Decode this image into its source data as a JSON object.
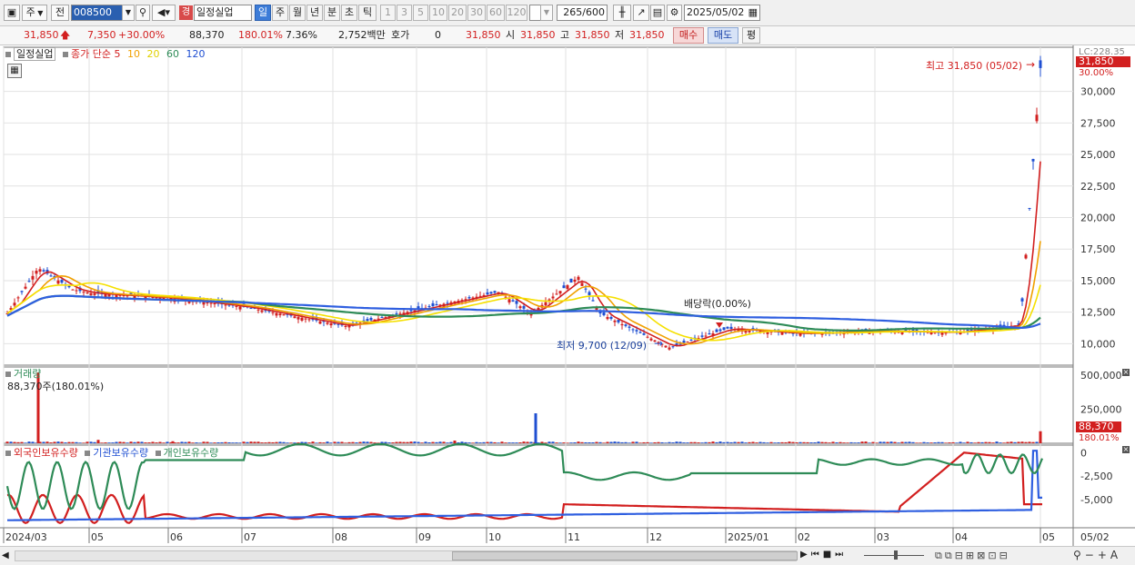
{
  "toolbar": {
    "mode_label": "주",
    "prev_label": "전",
    "code": "008500",
    "badge": "경",
    "stock_name": "일정실업",
    "periods": [
      "일",
      "주",
      "월",
      "년",
      "분",
      "초",
      "틱"
    ],
    "active_period": "일",
    "intervals": [
      "1",
      "3",
      "5",
      "10",
      "20",
      "30",
      "60",
      "120"
    ],
    "count_value": "265",
    "count_total": "/600",
    "date": "2025/05/02"
  },
  "quote": {
    "price": "31,850",
    "change": "7,350",
    "change_pct": "+30.00%",
    "volume": "88,370",
    "volume_ratio": "180.01%",
    "turnover": "7.36%",
    "amount": "2,752백만",
    "hoga_label": "호가",
    "hoga_value": "0",
    "hoga_price": "31,850",
    "open_label": "시",
    "open": "31,850",
    "high_label": "고",
    "high": "31,850",
    "low_label": "저",
    "low": "31,850",
    "buy_label": "매수",
    "sell_label": "매도",
    "flat_label": "평",
    "colors": {
      "up": "#d21f1f",
      "down": "#1f4fd2",
      "selected": "#3c7cd8"
    }
  },
  "price_legend": {
    "name": "일정실업",
    "ma_label": "종가 단순 5",
    "ma10": "10",
    "ma20": "20",
    "ma60": "60",
    "ma120": "120"
  },
  "annotations": {
    "high": "최고 31,850 (05/02)",
    "low": "최저 9,700 (12/09)",
    "dividend": "배당락(0.00%)",
    "current_price": "31,850",
    "current_pct": "30.00%",
    "lc": "LC:228.35"
  },
  "volume_panel": {
    "title": "거래량",
    "info": "88,370주(180.01%)",
    "current": "88,370",
    "current_pct": "180.01%"
  },
  "holding_panel": {
    "foreign": "외국인보유수량",
    "institution": "기관보유수량",
    "individual": "개인보유수량"
  },
  "chart_data": [
    {
      "type": "candlestick",
      "name": "price",
      "y_ticks": [
        "30,000",
        "27,500",
        "25,000",
        "22,500",
        "20,000",
        "17,500",
        "15,000",
        "12,500",
        "10,000"
      ],
      "ylim": [
        8300,
        33500
      ],
      "x_ticks": [
        "2024/03",
        "05",
        "06",
        "07",
        "08",
        "09",
        "10",
        "11",
        "12",
        "2025/01",
        "02",
        "03",
        "04",
        "05"
      ],
      "x_end_label": "05/02",
      "close_series": [
        {
          "date": "2024/03",
          "value": 12400
        },
        {
          "date": "2024/03 mid",
          "value": 16000
        },
        {
          "date": "2024/04",
          "value": 14300
        },
        {
          "date": "2024/05",
          "value": 14000
        },
        {
          "date": "2024/06",
          "value": 13600
        },
        {
          "date": "2024/07",
          "value": 12900
        },
        {
          "date": "2024/08",
          "value": 11400
        },
        {
          "date": "2024/09",
          "value": 12800
        },
        {
          "date": "2024/10",
          "value": 14100
        },
        {
          "date": "2024/10 end",
          "value": 12400
        },
        {
          "date": "2024/11",
          "value": 15300
        },
        {
          "date": "2024/11 end",
          "value": 12400
        },
        {
          "date": "2024/12/09",
          "value": 9700
        },
        {
          "date": "2025/01",
          "value": 11200
        },
        {
          "date": "2025/02",
          "value": 10800
        },
        {
          "date": "2025/03",
          "value": 11000
        },
        {
          "date": "2025/04",
          "value": 10900
        },
        {
          "date": "2025/04 end",
          "value": 11500
        },
        {
          "date": "2025/05/02",
          "value": 31850
        }
      ],
      "moving_averages": [
        "5",
        "10",
        "20",
        "60",
        "120"
      ]
    },
    {
      "type": "bar",
      "name": "volume",
      "y_ticks": [
        "500,000",
        "250,000"
      ],
      "ylim": [
        0,
        560000
      ],
      "spikes": [
        {
          "date": "2024/03",
          "value": 520000
        },
        {
          "date": "2024/05",
          "value": 25000
        },
        {
          "date": "2024/06",
          "value": 15000
        },
        {
          "date": "2024/10",
          "value": 20000
        },
        {
          "date": "2024/11",
          "value": 220000
        },
        {
          "date": "2025/05/02",
          "value": 88370
        }
      ]
    },
    {
      "type": "line",
      "name": "holdings",
      "y_ticks": [
        "0",
        "-2,500",
        "-5,000"
      ],
      "ylim": [
        -8000,
        800
      ],
      "series": [
        {
          "name": "외국인보유수량",
          "color": "#d21f1f"
        },
        {
          "name": "기관보유수량",
          "color": "#1f4fd2"
        },
        {
          "name": "개인보유수량",
          "color": "#2e8b57"
        }
      ]
    }
  ]
}
